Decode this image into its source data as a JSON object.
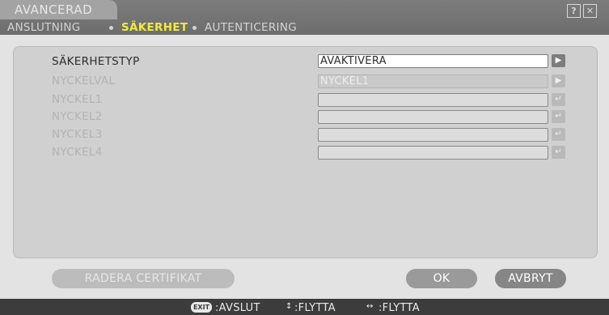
{
  "window": {
    "title": "AVANCERAD",
    "help_glyph": "?",
    "close_glyph": "✕"
  },
  "breadcrumb": {
    "items": [
      "ANSLUTNING",
      "SÄKERHET",
      "AUTENTICERING"
    ],
    "active_index": 1,
    "active_color": "#f2ea3a"
  },
  "settings": {
    "rows": [
      {
        "label": "SÄKERHETSTYP",
        "value": "AVAKTIVERA",
        "button": "▶",
        "enabled": true
      },
      {
        "label": "NYCKELVAL",
        "value": "NYCKEL1",
        "button": "▶",
        "enabled": false
      },
      {
        "label": "NYCKEL1",
        "value": "",
        "button": "↵",
        "enabled": false
      },
      {
        "label": "NYCKEL2",
        "value": "",
        "button": "↵",
        "enabled": false
      },
      {
        "label": "NYCKEL3",
        "value": "",
        "button": "↵",
        "enabled": false
      },
      {
        "label": "NYCKEL4",
        "value": "",
        "button": "↵",
        "enabled": false
      }
    ]
  },
  "buttons": {
    "delete_certificate": "RADERA CERTIFIKAT",
    "ok": "OK",
    "cancel": "AVBRYT"
  },
  "footer": {
    "exit_badge": "EXIT",
    "exit_label": ":AVSLUT",
    "updown_icon": "↕",
    "updown_label": ":FLYTTA",
    "leftright_icon": "↔",
    "leftright_label": ":FLYTTA"
  }
}
